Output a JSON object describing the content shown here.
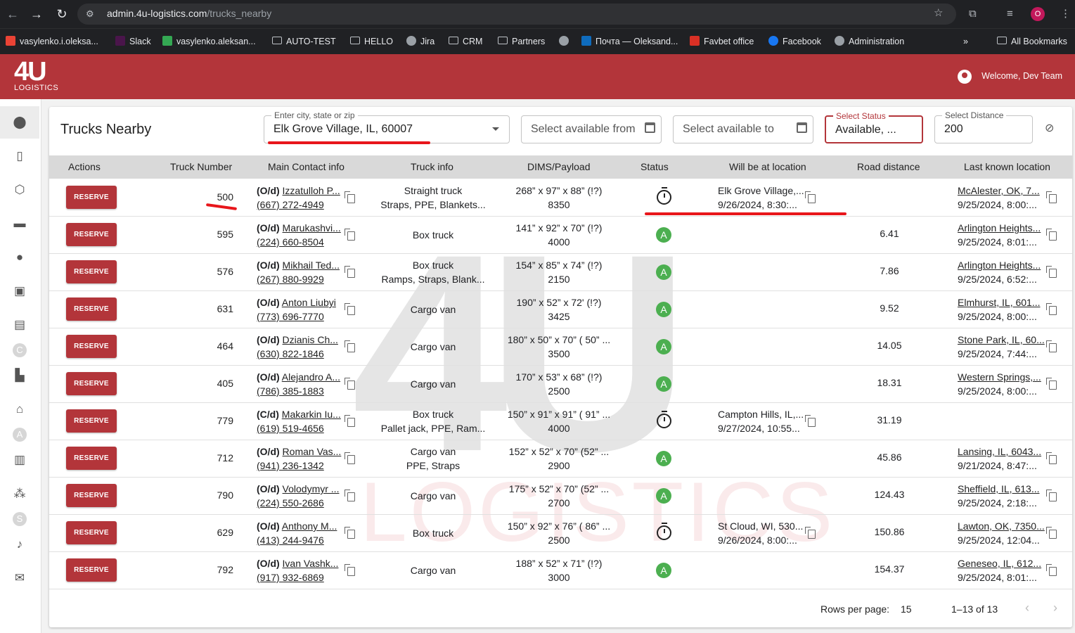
{
  "browser": {
    "url_host": "admin.4u-logistics.com",
    "url_path": "/trucks_nearby",
    "profile_letter": "O",
    "bookmarks": [
      {
        "label": "vasylenko.i.oleksa...",
        "color": "#ea4335"
      },
      {
        "label": "Slack",
        "color": "#4a154b"
      },
      {
        "label": "vasylenko.aleksan...",
        "color": "#34a853"
      },
      {
        "label": "AUTO-TEST",
        "color": "folder"
      },
      {
        "label": "HELLO",
        "color": "folder"
      },
      {
        "label": "Jira",
        "color": "#9aa0a6"
      },
      {
        "label": "CRM",
        "color": "folder"
      },
      {
        "label": "Partners",
        "color": "folder"
      },
      {
        "label": "",
        "color": "#9aa0a6"
      },
      {
        "label": "Почта — Oleksand...",
        "color": "#0f6cbd"
      },
      {
        "label": "Favbet office",
        "color": "#d93025"
      },
      {
        "label": "Facebook",
        "color": "#1877f2"
      },
      {
        "label": "Administration",
        "color": "#9aa0a6"
      }
    ],
    "more": "»",
    "all_bookmarks": "All Bookmarks"
  },
  "header": {
    "logo_main": "4U",
    "logo_sub": "LOGISTICS",
    "welcome": "Welcome, Dev Team"
  },
  "sidebar": {
    "items": [
      "location-icon",
      "map-icon",
      "cube-icon",
      "truck-icon",
      "person-icon",
      "contact-card-icon",
      "badge-icon",
      "letter-c",
      "factory-icon",
      "warehouse-icon",
      "letter-a",
      "clipboard-icon",
      "group-icon",
      "letter-s",
      "bell-icon",
      "mail-icon"
    ],
    "letters": {
      "c": "C",
      "a": "A",
      "s": "S"
    }
  },
  "page": {
    "title": "Trucks Nearby",
    "location_label": "Enter city, state or zip",
    "location_value": "Elk Grove Village, IL, 60007",
    "available_from_placeholder": "Select available from",
    "available_to_placeholder": "Select available to",
    "status_label": "Select Status",
    "status_value": "Available, ...",
    "distance_label": "Select Distance",
    "distance_value": "200"
  },
  "table": {
    "headers": [
      "Actions",
      "Truck Number",
      "Main Contact info",
      "Truck info",
      "DIMS/Payload",
      "Status",
      "Will be at location",
      "Road distance",
      "Last known location"
    ],
    "reserve_label": "RESERVE",
    "rows": [
      {
        "num": "500",
        "role": "(O/d)",
        "name": "Izzatulloh P...",
        "phone": "(667) 272-4949",
        "truck1": "Straight truck",
        "truck2": "Straps, PPE, Blankets...",
        "dims": "268” x 97” x 88” (!?)",
        "payload": "8350",
        "status": "clock",
        "will1": "Elk Grove Village,...",
        "will2": "9/26/2024, 8:30:...",
        "road": "",
        "loc1": "McAlester, OK, 7...",
        "loc2": "9/25/2024, 8:00:..."
      },
      {
        "num": "595",
        "role": "(O/d)",
        "name": "Marukashvi...",
        "phone": "(224) 660-8504",
        "truck1": "Box truck",
        "truck2": "",
        "dims": "141” x 92” x 70” (!?)",
        "payload": "4000",
        "status": "A",
        "will1": "",
        "will2": "",
        "road": "6.41",
        "loc1": "Arlington Heights...",
        "loc2": "9/25/2024, 8:01:..."
      },
      {
        "num": "576",
        "role": "(O/d)",
        "name": "Mikhail Ted...",
        "phone": "(267) 880-9929",
        "truck1": "Box truck",
        "truck2": "Ramps, Straps, Blank...",
        "dims": "154” x 85” x 74” (!?)",
        "payload": "2150",
        "status": "A",
        "will1": "",
        "will2": "",
        "road": "7.86",
        "loc1": "Arlington Heights...",
        "loc2": "9/25/2024, 6:52:..."
      },
      {
        "num": "631",
        "role": "(O/d)",
        "name": "Anton Liubyi",
        "phone": "(773) 696-7770",
        "truck1": "Cargo van",
        "truck2": "",
        "dims": "190” x 52” x 72' (!?)",
        "payload": "3425",
        "status": "A",
        "will1": "",
        "will2": "",
        "road": "9.52",
        "loc1": "Elmhurst, IL, 601...",
        "loc2": "9/25/2024, 8:00:..."
      },
      {
        "num": "464",
        "role": "(O/d)",
        "name": "Dzianis Ch...",
        "phone": "(630) 822-1846",
        "truck1": "Cargo van",
        "truck2": "",
        "dims": "180” x 50” x 70” ( 50” ...",
        "payload": "3500",
        "status": "A",
        "will1": "",
        "will2": "",
        "road": "14.05",
        "loc1": "Stone Park, IL, 60...",
        "loc2": "9/25/2024, 7:44:..."
      },
      {
        "num": "405",
        "role": "(O/d)",
        "name": "Alejandro A...",
        "phone": "(786) 385-1883",
        "truck1": "Cargo van",
        "truck2": "",
        "dims": "170” x 53” x 68” (!?)",
        "payload": "2500",
        "status": "A",
        "will1": "",
        "will2": "",
        "road": "18.31",
        "loc1": "Western Springs,...",
        "loc2": "9/25/2024, 8:00:..."
      },
      {
        "num": "779",
        "role": "(C/d)",
        "name": "Makarkin Iu...",
        "phone": "(619) 519-4656",
        "truck1": "Box truck",
        "truck2": "Pallet jack, PPE, Ram...",
        "dims": "150” x 91” x 91” ( 91” ...",
        "payload": "4000",
        "status": "clock",
        "will1": "Campton Hills, IL,...",
        "will2": "9/27/2024, 10:55...",
        "road": "31.19",
        "loc1": "",
        "loc2": ""
      },
      {
        "num": "712",
        "role": "(O/d)",
        "name": "Roman Vas...",
        "phone": "(941) 236-1342",
        "truck1": "Cargo van",
        "truck2": "PPE, Straps",
        "dims": "152” x 52” x 70” (52” ...",
        "payload": "2900",
        "status": "A",
        "will1": "",
        "will2": "",
        "road": "45.86",
        "loc1": "Lansing, IL, 6043...",
        "loc2": "9/21/2024, 8:47:..."
      },
      {
        "num": "790",
        "role": "(O/d)",
        "name": "Volodymyr ...",
        "phone": "(224) 550-2686",
        "truck1": "Cargo van",
        "truck2": "",
        "dims": "175” x 52” x 70” (52” ...",
        "payload": "2700",
        "status": "A",
        "will1": "",
        "will2": "",
        "road": "124.43",
        "loc1": "Sheffield, IL, 613...",
        "loc2": "9/25/2024, 2:18:..."
      },
      {
        "num": "629",
        "role": "(O/d)",
        "name": "Anthony M...",
        "phone": "(413) 244-9476",
        "truck1": "Box truck",
        "truck2": "",
        "dims": "150” x 92” x 76” ( 86” ...",
        "payload": "2500",
        "status": "clock",
        "will1": "St Cloud, WI, 530...",
        "will2": "9/26/2024, 8:00:...",
        "road": "150.86",
        "loc1": "Lawton, OK, 7350...",
        "loc2": "9/25/2024, 12:04..."
      },
      {
        "num": "792",
        "role": "(O/d)",
        "name": "Ivan Vashk...",
        "phone": "(917) 932-6869",
        "truck1": "Cargo van",
        "truck2": "",
        "dims": "188” x 52” x 71” (!?)",
        "payload": "3000",
        "status": "A",
        "will1": "",
        "will2": "",
        "road": "154.37",
        "loc1": "Geneseo, IL, 612...",
        "loc2": "9/25/2024, 8:01:..."
      }
    ]
  },
  "pagination": {
    "rows_per_page_label": "Rows per page:",
    "rows_per_page": "15",
    "range": "1–13 of 13"
  },
  "watermark": {
    "big": "4U",
    "sub": "LOGISTICS"
  },
  "colors": {
    "brand": "#b3353a",
    "status_available": "#4caf50",
    "annotation": "#e8161b"
  }
}
